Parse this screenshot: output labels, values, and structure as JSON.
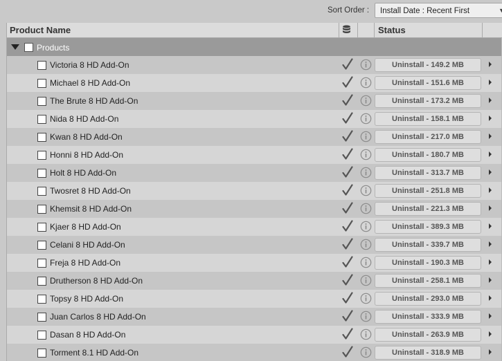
{
  "sort": {
    "label": "Sort Order :",
    "value": "Install Date : Recent First"
  },
  "table": {
    "columns": {
      "name": "Product Name",
      "status": "Status"
    }
  },
  "group": {
    "label": "Products"
  },
  "rows": [
    {
      "name": "Victoria 8 HD Add-On",
      "status": "Uninstall - 149.2 MB"
    },
    {
      "name": "Michael 8 HD Add-On",
      "status": "Uninstall - 151.6 MB"
    },
    {
      "name": "The Brute 8 HD Add-On",
      "status": "Uninstall - 173.2 MB"
    },
    {
      "name": "Nida 8 HD Add-On",
      "status": "Uninstall - 158.1 MB"
    },
    {
      "name": "Kwan 8 HD Add-On",
      "status": "Uninstall - 217.0 MB"
    },
    {
      "name": "Honni 8 HD Add-On",
      "status": "Uninstall - 180.7 MB"
    },
    {
      "name": "Holt 8 HD Add-On",
      "status": "Uninstall - 313.7 MB"
    },
    {
      "name": "Twosret 8 HD Add-On",
      "status": "Uninstall - 251.8 MB"
    },
    {
      "name": "Khemsit 8 HD Add-On",
      "status": "Uninstall - 221.3 MB"
    },
    {
      "name": "Kjaer 8 HD Add-On",
      "status": "Uninstall - 389.3 MB"
    },
    {
      "name": "Celani 8 HD Add-On",
      "status": "Uninstall - 339.7 MB"
    },
    {
      "name": "Freja 8 HD Add-On",
      "status": "Uninstall - 190.3 MB"
    },
    {
      "name": "Drutherson 8 HD Add-On",
      "status": "Uninstall - 258.1 MB"
    },
    {
      "name": "Topsy 8 HD Add-On",
      "status": "Uninstall - 293.0 MB"
    },
    {
      "name": "Juan Carlos 8 HD Add-On",
      "status": "Uninstall - 333.9 MB"
    },
    {
      "name": "Dasan 8 HD Add-On",
      "status": "Uninstall - 263.9 MB"
    },
    {
      "name": "Torment 8.1 HD Add-On",
      "status": "Uninstall - 318.9 MB"
    }
  ],
  "icons": {
    "column_database": "database-icon",
    "installed": "checkmark-icon",
    "info": "info-icon",
    "expand": "triangle-down-icon",
    "row_arrow": "arrow-right-icon"
  }
}
